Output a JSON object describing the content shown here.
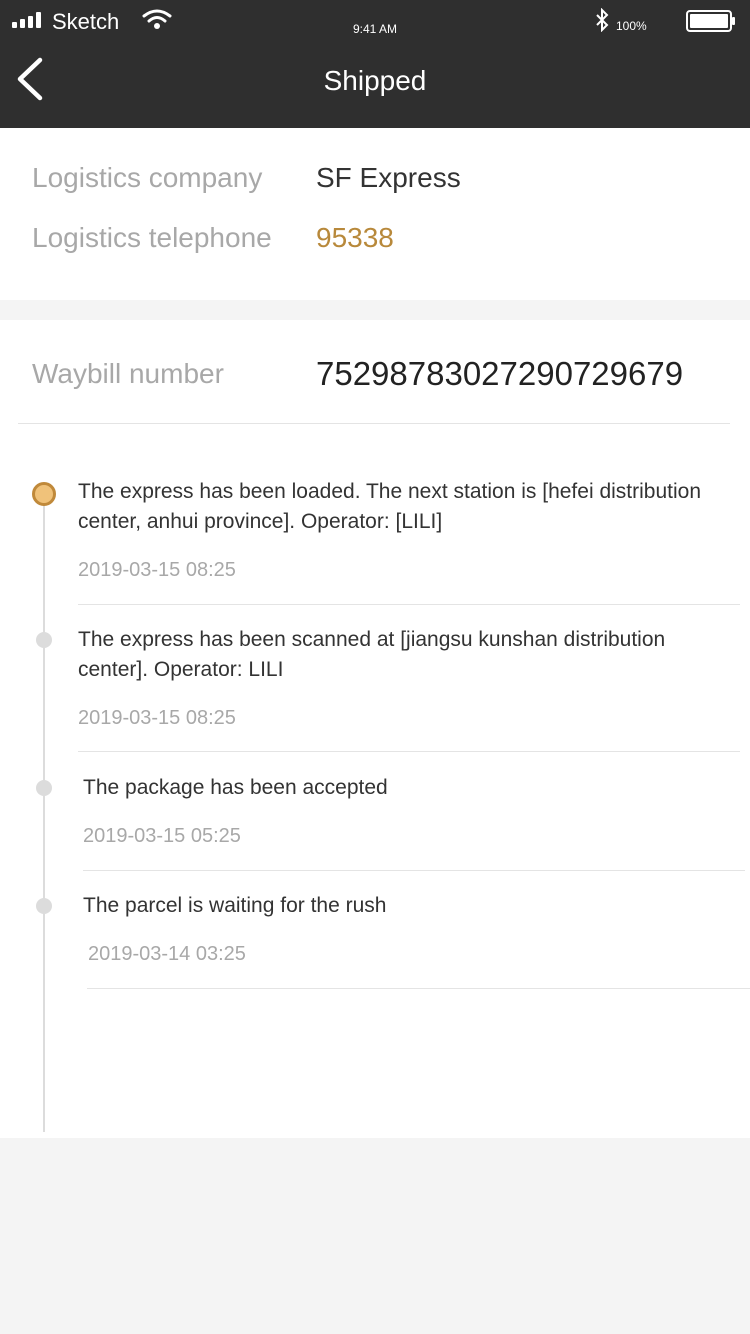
{
  "status_bar": {
    "carrier": "Sketch",
    "time": "9:41 AM",
    "battery": "100%"
  },
  "nav": {
    "title": "Shipped"
  },
  "logistics": {
    "company_label": "Logistics company",
    "company_value": "SF Express",
    "phone_label": "Logistics telephone",
    "phone_value": "95338"
  },
  "waybill": {
    "label": "Waybill number",
    "value": "75298783027290729679"
  },
  "timeline": [
    {
      "text": "The express has been loaded. The next station is [hefei distribution center, anhui province]. Operator: [LILI]",
      "time": "2019-03-15  08:25",
      "active": true
    },
    {
      "text": "The express has been scanned at [jiangsu kunshan distribution center]. Operator: LILI",
      "time": "2019-03-15  08:25",
      "active": false
    },
    {
      "text": "The package has been accepted",
      "time": "2019-03-15  05:25",
      "active": false
    },
    {
      "text": "The parcel is waiting for the rush",
      "time": "2019-03-14  03:25",
      "active": false
    }
  ],
  "colors": {
    "header_bg": "#2f2f2f",
    "accent": "#b8893b",
    "active_dot": "#c0893a"
  }
}
